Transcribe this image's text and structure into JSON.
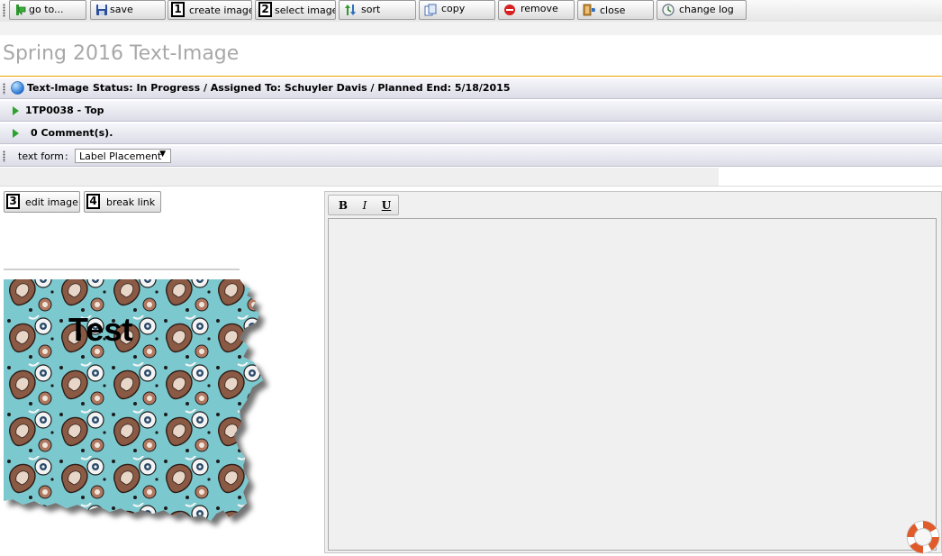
{
  "toolbar": {
    "go_to": "go to...",
    "save": "save",
    "create_image": {
      "num": "1",
      "label": "create image"
    },
    "select_image": {
      "num": "2",
      "label": "select image"
    },
    "sort": "sort",
    "copy": "copy",
    "remove": "remove",
    "close": "close",
    "change_log": "change log"
  },
  "page_title": "Spring 2016 Text-Image",
  "header": {
    "type": "Text-Image",
    "status_line": "Status: In Progress / Assigned To: Schuyler Davis / Planned End: 5/18/2015"
  },
  "sections": {
    "item": "1TP0038 - Top",
    "comments": "0 Comment(s)."
  },
  "form": {
    "label": "text form",
    "colon": ":",
    "select_value": "Label Placement"
  },
  "image_actions": {
    "edit": {
      "num": "3",
      "label": "edit image"
    },
    "break": {
      "num": "4",
      "label": "break link"
    }
  },
  "editor": {
    "bold": "B",
    "italic": "I",
    "underline": "U",
    "content": ""
  },
  "image": {
    "overlay_text": "Test"
  },
  "colors": {
    "accent_line": "#e9a300",
    "title_grey": "#a8a8a8",
    "arrow_green": "#2ea22e"
  }
}
